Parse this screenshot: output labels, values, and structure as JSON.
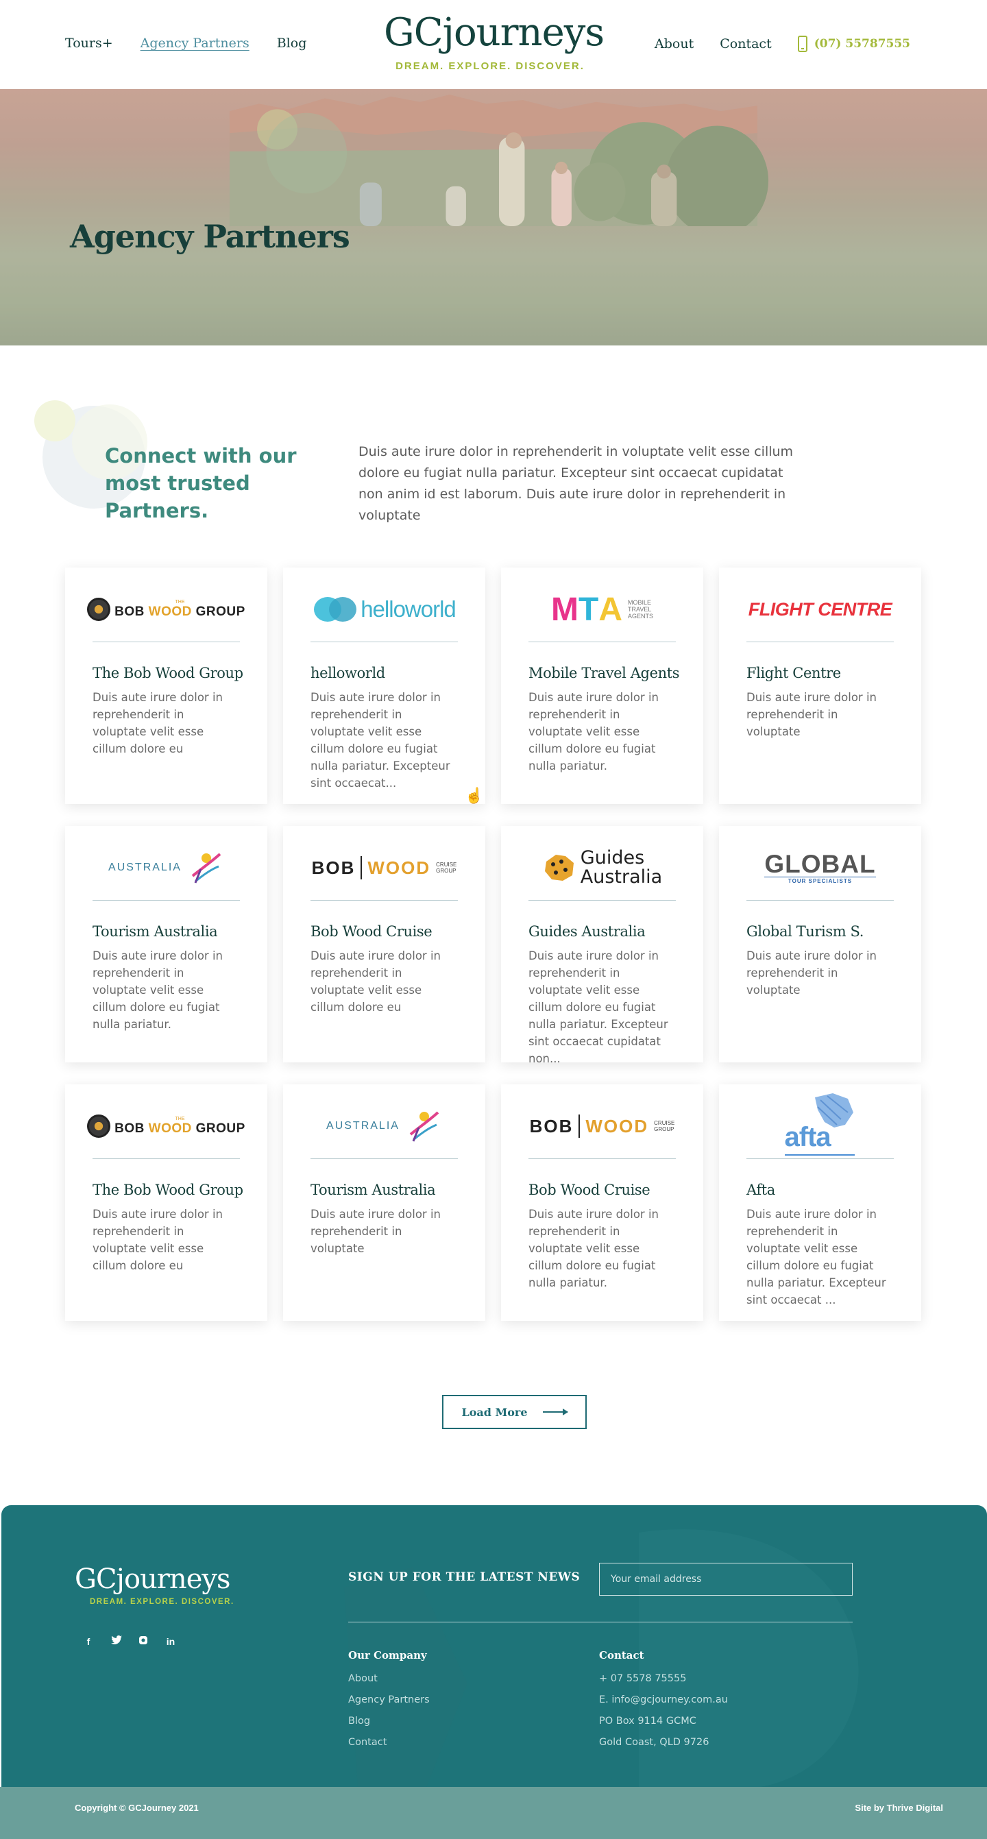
{
  "nav": {
    "left": [
      "Tours+",
      "Agency Partners",
      "Blog"
    ],
    "right": [
      "About",
      "Contact"
    ],
    "phone": "(07) 55787555",
    "logo_text": "GCjourneys",
    "tagline": "DREAM. EXPLORE. DISCOVER."
  },
  "hero": {
    "title": "Agency Partners"
  },
  "intro": {
    "heading": "Connect with our most trusted Partners.",
    "text": "Duis aute irure dolor in reprehenderit in voluptate velit esse cillum dolore eu fugiat nulla pariatur. Excepteur sint occaecat cupidatat non anim id est laborum. Duis aute irure dolor in reprehenderit in voluptate"
  },
  "partners": [
    {
      "title": "The Bob Wood Group",
      "desc": "Duis aute irure dolor in reprehenderit in voluptate velit esse cillum dolore eu",
      "logo": "bob-wood-group-logo"
    },
    {
      "title": "helloworld",
      "desc": "Duis aute irure dolor in reprehenderit in voluptate velit esse cillum dolore eu fugiat nulla pariatur. Excepteur sint occaecat...",
      "logo": "helloworld-logo"
    },
    {
      "title": "Mobile Travel Agents",
      "desc": "Duis aute irure dolor in reprehenderit in voluptate velit esse cillum dolore eu fugiat nulla pariatur.",
      "logo": "mta-logo"
    },
    {
      "title": "Flight Centre",
      "desc": "Duis aute irure dolor in reprehenderit in voluptate",
      "logo": "flight-centre-logo"
    },
    {
      "title": "Tourism Australia",
      "desc": "Duis aute irure dolor in reprehenderit in voluptate velit esse cillum dolore eu fugiat nulla pariatur.",
      "logo": "tourism-australia-logo"
    },
    {
      "title": "Bob Wood Cruise",
      "desc": "Duis aute irure dolor in reprehenderit in voluptate velit esse cillum dolore eu",
      "logo": "bob-wood-cruise-logo"
    },
    {
      "title": "Guides Australia",
      "desc": "Duis aute irure dolor in reprehenderit in voluptate velit esse cillum dolore eu fugiat nulla pariatur. Excepteur sint occaecat cupidatat non...",
      "logo": "guides-australia-logo"
    },
    {
      "title": "Global Turism S.",
      "desc": "Duis aute irure dolor in reprehenderit in voluptate",
      "logo": "global-tourism-logo"
    },
    {
      "title": "The Bob Wood Group",
      "desc": "Duis aute irure dolor in reprehenderit in voluptate velit esse cillum dolore eu",
      "logo": "bob-wood-group-logo"
    },
    {
      "title": "Tourism Australia",
      "desc": "Duis aute irure dolor in reprehenderit in voluptate",
      "logo": "tourism-australia-logo"
    },
    {
      "title": "Bob Wood Cruise",
      "desc": "Duis aute irure dolor in reprehenderit in voluptate velit esse cillum dolore eu fugiat nulla pariatur.",
      "logo": "bob-wood-cruise-logo"
    },
    {
      "title": "Afta",
      "desc": "Duis aute irure dolor in reprehenderit in voluptate velit esse cillum dolore eu fugiat nulla pariatur. Excepteur sint occaecat ...",
      "logo": "afta-logo"
    }
  ],
  "brand_logos": {
    "bob_wood": {
      "the": "THE",
      "bob": "BOB",
      "wood": "WOOD",
      "group": "GROUP"
    },
    "helloworld": "helloworld",
    "mta": {
      "letters": [
        "M",
        "T",
        "A"
      ],
      "lines": [
        "MOBILE",
        "TRAVEL",
        "AGENTS"
      ]
    },
    "flight_centre": "FLIGHT CENTRE",
    "tourism_australia": "AUSTRALIA",
    "bob_wood_cruise": {
      "bob": "BOB",
      "wood": "WOOD",
      "cruise": "CRUISE",
      "group": "GROUP"
    },
    "guides_australia": [
      "Guides",
      "Australia"
    ],
    "global": {
      "word": "GLOBAL",
      "sub": "TOUR SPECIALISTS"
    },
    "afta": "afta"
  },
  "load_more": "Load More",
  "footer": {
    "logo_text": "GCjourneys",
    "tagline": "DREAM. EXPLORE. DISCOVER.",
    "social": [
      "f",
      "t",
      "i",
      "in"
    ],
    "signup": "SIGN UP FOR THE LATEST NEWS",
    "email_placeholder": "Your email address",
    "company_title": "Our Company",
    "company_links": [
      "About",
      "Agency Partners",
      "Blog",
      "Contact"
    ],
    "contact_title": "Contact",
    "contact_lines": [
      "+ 07 5578 75555",
      "E. info@gcjourney.com.au",
      "PO Box 9114 GCMC",
      "Gold Coast, QLD 9726"
    ],
    "copyright": "Copyright © GCJourney 2021",
    "credit": "Site by Thrive Digital"
  },
  "colors": {
    "primary_dark": "#14433d",
    "accent_lime": "#a3b93a",
    "teal": "#1e7479",
    "teal_link": "#4f8fa0",
    "copy_bar": "#6a9f9a"
  }
}
